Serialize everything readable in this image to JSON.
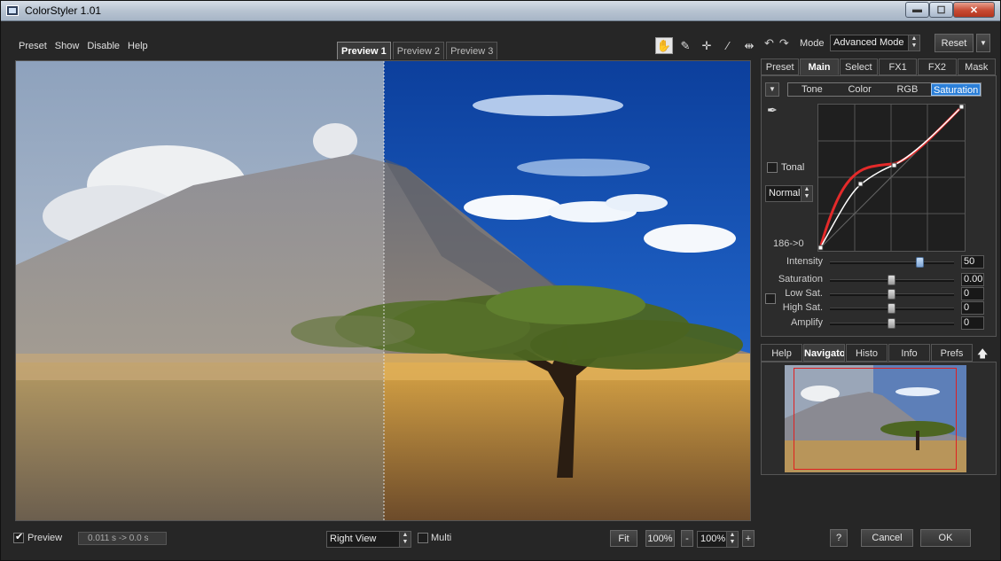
{
  "window": {
    "title": "ColorStyler 1.01",
    "min_glyph": "▬",
    "max_glyph": "☐",
    "close_glyph": "✕"
  },
  "menu": [
    "Preset",
    "Show",
    "Disable",
    "Help"
  ],
  "preview_tabs": [
    {
      "label": "Preview 1",
      "active": true
    },
    {
      "label": "Preview 2",
      "active": false
    },
    {
      "label": "Preview 3",
      "active": false
    }
  ],
  "tools": [
    {
      "name": "hand-tool-icon",
      "glyph": "✋",
      "active": true
    },
    {
      "name": "eyedropper-tool-icon",
      "glyph": "✎",
      "active": false
    },
    {
      "name": "crosshair-tool-icon",
      "glyph": "✛",
      "active": false
    },
    {
      "name": "brush-tool-icon",
      "glyph": "⁄",
      "active": false
    },
    {
      "name": "split-view-tool-icon",
      "glyph": "⇹",
      "active": false
    }
  ],
  "header": {
    "undo_glyph": "↶",
    "redo_glyph": "↷",
    "mode_label": "Mode",
    "mode_value": "Advanced Mode",
    "reset_label": "Reset",
    "reset_dropdown": "▼"
  },
  "main_tabs": [
    {
      "label": "Preset",
      "active": false
    },
    {
      "label": "Main",
      "active": true
    },
    {
      "label": "Select",
      "active": false
    },
    {
      "label": "FX1",
      "active": false
    },
    {
      "label": "FX2",
      "active": false
    },
    {
      "label": "Mask",
      "active": false
    }
  ],
  "sub_tabs": [
    {
      "label": "Tone",
      "active": false
    },
    {
      "label": "Color",
      "active": false
    },
    {
      "label": "RGB",
      "active": false
    },
    {
      "label": "Saturation",
      "active": true
    }
  ],
  "curve": {
    "picker_glyph": "✒",
    "tonal_label": "Tonal",
    "blend_mode": "Normal",
    "readout": "186->0"
  },
  "sliders": [
    {
      "key": "intensity",
      "label": "Intensity",
      "value": "50",
      "position": 0.72,
      "blue": true
    },
    {
      "key": "saturation",
      "label": "Saturation",
      "value": "0.00",
      "position": 0.5,
      "blue": false
    },
    {
      "key": "low_sat",
      "label": "Low Sat.",
      "value": "0",
      "position": 0.5,
      "blue": false
    },
    {
      "key": "high_sat",
      "label": "High Sat.",
      "value": "0",
      "position": 0.5,
      "blue": false
    },
    {
      "key": "amplify",
      "label": "Amplify",
      "value": "0",
      "position": 0.5,
      "blue": false
    }
  ],
  "bottom_tabs": [
    {
      "label": "Help",
      "active": false
    },
    {
      "label": "Navigator",
      "active": true
    },
    {
      "label": "Histo",
      "active": false
    },
    {
      "label": "Info",
      "active": false
    },
    {
      "label": "Prefs",
      "active": false
    }
  ],
  "bottom_up_glyph": "🡅",
  "status": {
    "preview_label": "Preview",
    "preview_checked": true,
    "timing": "0.011 s -> 0.0 s",
    "view_mode": "Right View",
    "multi_label": "Multi",
    "fit_label": "Fit",
    "zoom_100_label": "100%",
    "zoom_minus": "-",
    "zoom_value": "100%",
    "zoom_plus": "+"
  },
  "dialog": {
    "help_label": "?",
    "cancel_label": "Cancel",
    "ok_label": "OK"
  }
}
